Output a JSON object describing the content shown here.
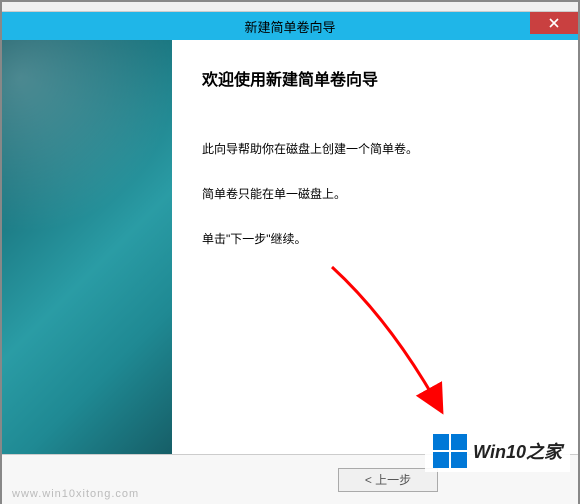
{
  "titlebar": {
    "title": "新建简单卷向导"
  },
  "content": {
    "heading": "欢迎使用新建简单卷向导",
    "para1": "此向导帮助你在磁盘上创建一个简单卷。",
    "para2": "简单卷只能在单一磁盘上。",
    "para3": "单击\"下一步\"继续。"
  },
  "footer": {
    "back_label": "< 上一步"
  },
  "watermark": {
    "text": "Win10之家",
    "url": "www.win10xitong.com"
  }
}
